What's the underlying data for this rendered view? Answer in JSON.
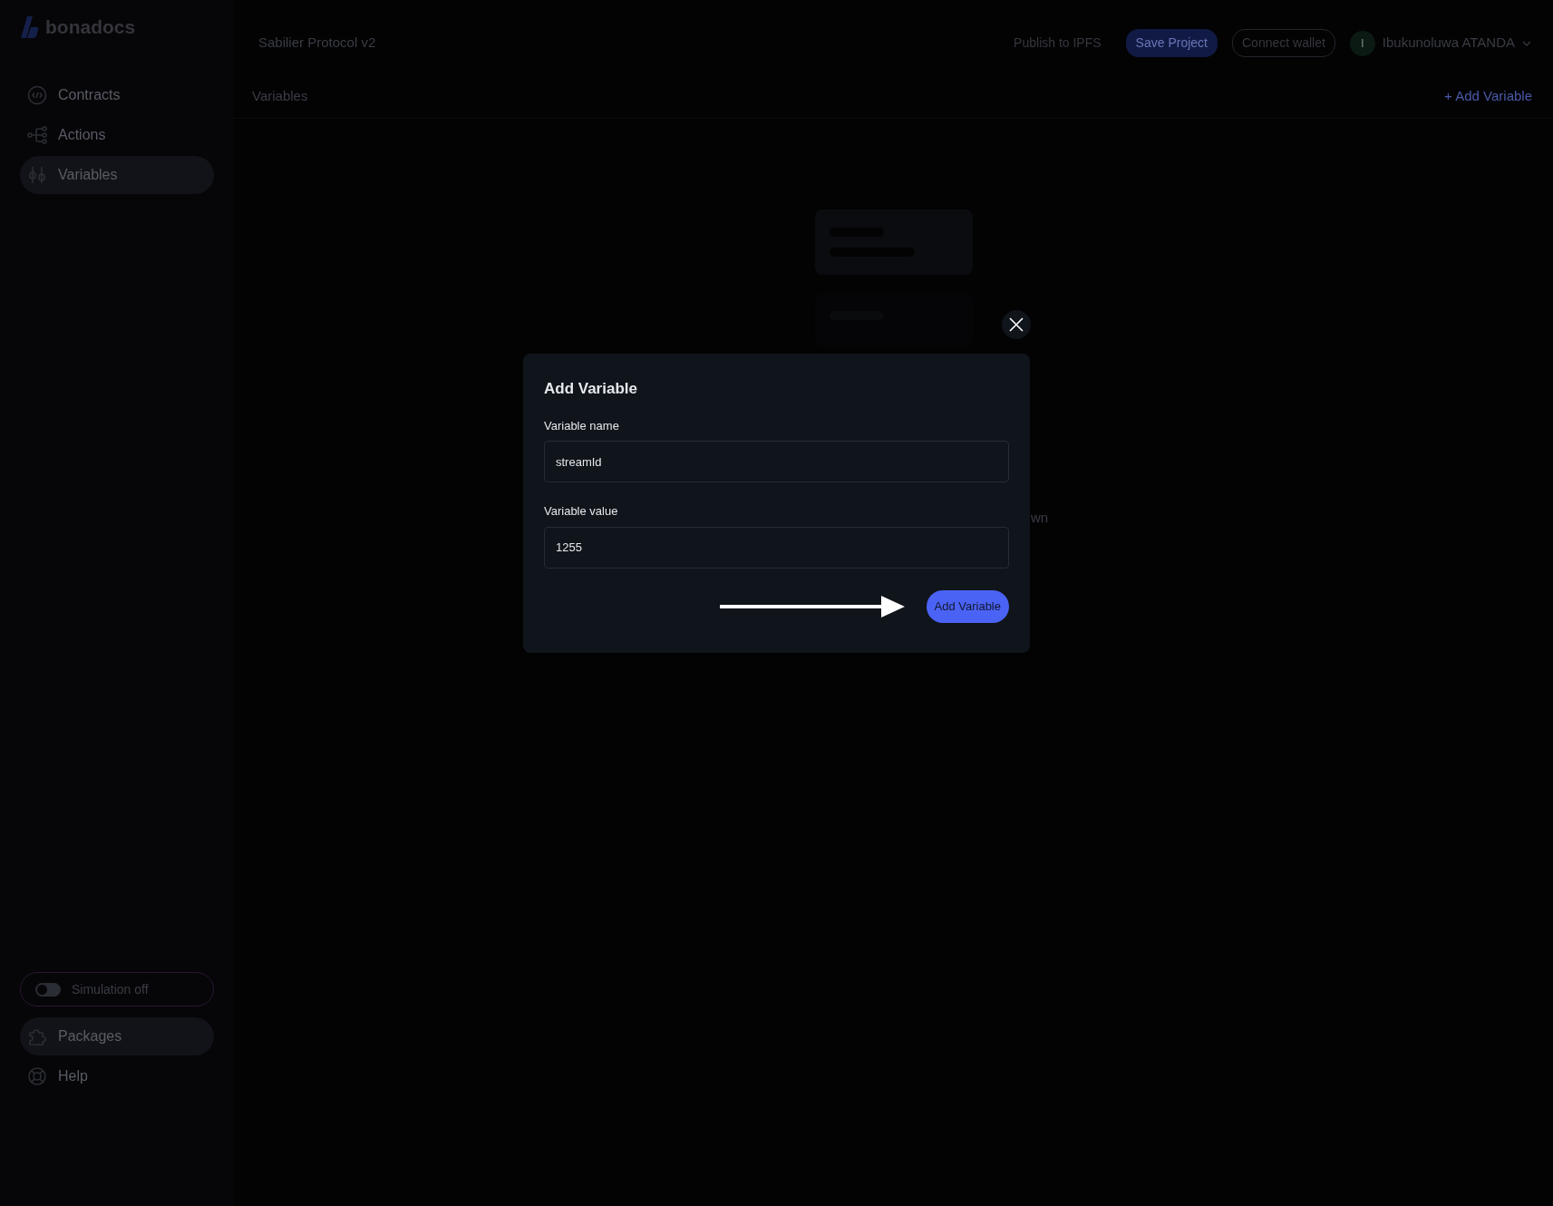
{
  "app": {
    "logo": "bonadocs"
  },
  "sidebar": {
    "items": [
      {
        "label": "Contracts",
        "selected": false
      },
      {
        "label": "Actions",
        "selected": false
      },
      {
        "label": "Variables",
        "selected": true
      }
    ],
    "simulation": {
      "label": "Simulation off",
      "on": false
    },
    "footer_items": [
      {
        "label": "Packages",
        "selected": true
      },
      {
        "label": "Help",
        "selected": false
      }
    ]
  },
  "header": {
    "project_title": "Sabilier Protocol v2",
    "actions": [
      {
        "label": "Publish to IPFS",
        "kind": "text"
      },
      {
        "label": "Save Project",
        "kind": "primary"
      },
      {
        "label": "Connect wallet",
        "kind": "outline"
      }
    ],
    "user": {
      "initial": "I",
      "name": "Ibukunoluwa ATANDA"
    }
  },
  "section": {
    "title": "Variables",
    "add_link": "+ Add Variable"
  },
  "empty_state_fragment": "wn",
  "modal": {
    "title": "Add Variable",
    "fields": [
      {
        "label": "Variable name",
        "value": "streamId"
      },
      {
        "label": "Variable value",
        "value": "1255"
      }
    ],
    "submit": "Add Variable"
  }
}
